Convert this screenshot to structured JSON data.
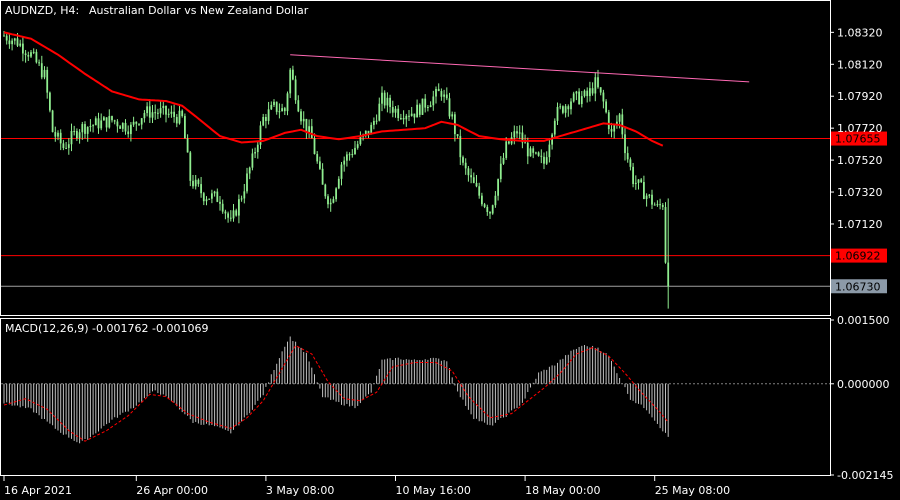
{
  "header": {
    "symbol_timeframe": "AUDNZD, H4:",
    "description": "Australian Dollar vs New Zealand Dollar"
  },
  "macd_header": "MACD(12,26,9) -0.001762 -0.001069",
  "colors": {
    "background": "#000000",
    "candle": "#90ee90",
    "moving_average": "#ff0000",
    "trendline": "#ff69b4",
    "price_line": "#ff0000",
    "current_price_line": "#a0a0a0",
    "price_tag": "#ff0000",
    "current_tag": "#8c9aa8",
    "histogram": "#c0c0c0",
    "signal": "#ff0000",
    "frame": "#ffffff"
  },
  "chart_data": [
    {
      "type": "candlestick",
      "panel": "price",
      "yticks": [
        "1.08320",
        "1.08120",
        "1.07920",
        "1.07720",
        "1.07520",
        "1.07320",
        "1.07120"
      ],
      "ylim": [
        1.0655,
        1.0851
      ],
      "xticks": [
        {
          "label": "16 Apr 2021",
          "bar": 0
        },
        {
          "label": "26 Apr 00:00",
          "bar": 49
        },
        {
          "label": "3 May 08:00",
          "bar": 97
        },
        {
          "label": "10 May 16:00",
          "bar": 145
        },
        {
          "label": "18 May 00:00",
          "bar": 193
        },
        {
          "label": "25 May 08:00",
          "bar": 241
        }
      ],
      "horizontal_levels": [
        {
          "value": 1.07655,
          "label": "1.07655",
          "style": "red"
        },
        {
          "value": 1.06922,
          "label": "1.06922",
          "style": "red"
        },
        {
          "value": 1.0673,
          "label": "1.06730",
          "style": "current"
        }
      ],
      "trendline": {
        "from": {
          "bar": 106,
          "price": 1.0818
        },
        "to": {
          "bar": 276,
          "price": 1.0801
        }
      },
      "closes_keypoints": [
        [
          0,
          1.083
        ],
        [
          5,
          1.0826
        ],
        [
          10,
          1.0818
        ],
        [
          15,
          1.0805
        ],
        [
          18,
          1.077
        ],
        [
          22,
          1.076
        ],
        [
          28,
          1.0772
        ],
        [
          35,
          1.0775
        ],
        [
          40,
          1.0777
        ],
        [
          47,
          1.0772
        ],
        [
          52,
          1.0782
        ],
        [
          58,
          1.0782
        ],
        [
          66,
          1.0778
        ],
        [
          69,
          1.074
        ],
        [
          74,
          1.073
        ],
        [
          80,
          1.0728
        ],
        [
          84,
          1.0712
        ],
        [
          88,
          1.073
        ],
        [
          92,
          1.0752
        ],
        [
          96,
          1.0778
        ],
        [
          100,
          1.0785
        ],
        [
          104,
          1.0783
        ],
        [
          106,
          1.0808
        ],
        [
          110,
          1.078
        ],
        [
          114,
          1.0765
        ],
        [
          118,
          1.0735
        ],
        [
          121,
          1.0725
        ],
        [
          125,
          1.075
        ],
        [
          130,
          1.076
        ],
        [
          136,
          1.0772
        ],
        [
          140,
          1.079
        ],
        [
          146,
          1.0782
        ],
        [
          152,
          1.0782
        ],
        [
          158,
          1.079
        ],
        [
          162,
          1.0795
        ],
        [
          166,
          1.0778
        ],
        [
          170,
          1.0748
        ],
        [
          176,
          1.073
        ],
        [
          180,
          1.072
        ],
        [
          186,
          1.076
        ],
        [
          190,
          1.077
        ],
        [
          195,
          1.0755
        ],
        [
          200,
          1.075
        ],
        [
          204,
          1.078
        ],
        [
          210,
          1.079
        ],
        [
          216,
          1.0792
        ],
        [
          219,
          1.08
        ],
        [
          222,
          1.0788
        ],
        [
          225,
          1.0768
        ],
        [
          228,
          1.078
        ],
        [
          230,
          1.076
        ],
        [
          233,
          1.074
        ],
        [
          238,
          1.073
        ],
        [
          242,
          1.0722
        ],
        [
          244,
          1.0725
        ],
        [
          245,
          1.069
        ],
        [
          246,
          1.0673
        ]
      ],
      "ma_keypoints": [
        [
          0,
          1.0832
        ],
        [
          10,
          1.0828
        ],
        [
          20,
          1.0818
        ],
        [
          30,
          1.0806
        ],
        [
          40,
          1.0795
        ],
        [
          50,
          1.079
        ],
        [
          60,
          1.0789
        ],
        [
          66,
          1.0786
        ],
        [
          72,
          1.0778
        ],
        [
          80,
          1.0767
        ],
        [
          88,
          1.0763
        ],
        [
          96,
          1.0764
        ],
        [
          104,
          1.0769
        ],
        [
          110,
          1.0771
        ],
        [
          116,
          1.0767
        ],
        [
          124,
          1.0765
        ],
        [
          132,
          1.0767
        ],
        [
          140,
          1.077
        ],
        [
          148,
          1.0771
        ],
        [
          156,
          1.0772
        ],
        [
          162,
          1.0776
        ],
        [
          168,
          1.0774
        ],
        [
          176,
          1.0767
        ],
        [
          184,
          1.0765
        ],
        [
          192,
          1.0764
        ],
        [
          200,
          1.0764
        ],
        [
          208,
          1.0768
        ],
        [
          216,
          1.0772
        ],
        [
          222,
          1.0775
        ],
        [
          228,
          1.0774
        ],
        [
          234,
          1.077
        ],
        [
          240,
          1.0764
        ],
        [
          244,
          1.0761
        ]
      ]
    },
    {
      "type": "bar",
      "panel": "macd",
      "yticks": [
        "0.001500",
        "0.000000",
        "-0.002145"
      ],
      "ylim": [
        -0.002145,
        0.0015
      ],
      "histogram_keypoints": [
        [
          0,
          -0.00045
        ],
        [
          10,
          -0.0006
        ],
        [
          20,
          -0.0011
        ],
        [
          28,
          -0.0014
        ],
        [
          32,
          -0.00125
        ],
        [
          40,
          -0.00085
        ],
        [
          48,
          -0.00055
        ],
        [
          56,
          -0.00015
        ],
        [
          62,
          -0.0004
        ],
        [
          70,
          -0.0009
        ],
        [
          78,
          -0.001
        ],
        [
          84,
          -0.00115
        ],
        [
          90,
          -0.00075
        ],
        [
          96,
          -0.00025
        ],
        [
          100,
          0.00035
        ],
        [
          104,
          0.0009
        ],
        [
          106,
          0.0011
        ],
        [
          112,
          0.0007
        ],
        [
          118,
          -0.0003
        ],
        [
          124,
          -0.00045
        ],
        [
          130,
          -0.00055
        ],
        [
          136,
          -0.0002
        ],
        [
          140,
          0.00055
        ],
        [
          146,
          0.0006
        ],
        [
          152,
          0.00055
        ],
        [
          158,
          0.0006
        ],
        [
          164,
          0.00055
        ],
        [
          168,
          -0.0002
        ],
        [
          174,
          -0.0008
        ],
        [
          180,
          -0.001
        ],
        [
          186,
          -0.00075
        ],
        [
          192,
          -0.00045
        ],
        [
          198,
          0.00025
        ],
        [
          204,
          0.00045
        ],
        [
          210,
          0.00075
        ],
        [
          214,
          0.0009
        ],
        [
          220,
          0.00085
        ],
        [
          224,
          0.00065
        ],
        [
          228,
          0.00015
        ],
        [
          232,
          -0.00035
        ],
        [
          238,
          -0.0006
        ],
        [
          244,
          -0.0011
        ],
        [
          246,
          -0.00125
        ]
      ],
      "signal_keypoints": [
        [
          0,
          -0.0005
        ],
        [
          8,
          -0.00035
        ],
        [
          16,
          -0.0006
        ],
        [
          24,
          -0.0011
        ],
        [
          30,
          -0.00135
        ],
        [
          38,
          -0.0011
        ],
        [
          46,
          -0.00075
        ],
        [
          54,
          -0.00025
        ],
        [
          60,
          -0.0003
        ],
        [
          68,
          -0.0007
        ],
        [
          76,
          -0.0009
        ],
        [
          84,
          -0.00105
        ],
        [
          90,
          -0.0008
        ],
        [
          96,
          -0.0004
        ],
        [
          102,
          0.00025
        ],
        [
          108,
          0.0009
        ],
        [
          114,
          0.0007
        ],
        [
          120,
          5e-05
        ],
        [
          126,
          -0.00035
        ],
        [
          132,
          -0.0004
        ],
        [
          138,
          -0.0002
        ],
        [
          144,
          0.0004
        ],
        [
          152,
          0.0005
        ],
        [
          160,
          0.0005
        ],
        [
          166,
          0.0003
        ],
        [
          172,
          -0.0003
        ],
        [
          180,
          -0.0008
        ],
        [
          188,
          -0.0007
        ],
        [
          194,
          -0.0004
        ],
        [
          200,
          -0.0001
        ],
        [
          206,
          0.00025
        ],
        [
          212,
          0.0007
        ],
        [
          218,
          0.00085
        ],
        [
          224,
          0.00065
        ],
        [
          230,
          0.00025
        ],
        [
          236,
          -0.0002
        ],
        [
          242,
          -0.0006
        ],
        [
          246,
          -0.0009
        ]
      ]
    }
  ]
}
